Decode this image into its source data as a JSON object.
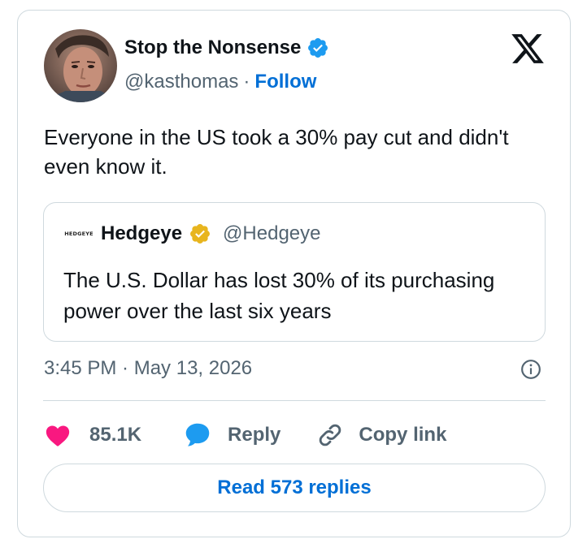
{
  "author": {
    "name": "Stop the Nonsense",
    "handle": "@kasthomas",
    "separator": "·",
    "follow_label": "Follow",
    "verified_color": "#1d9bf0"
  },
  "tweet": {
    "text": "Everyone in the US took a 30% pay cut and didn't even know it."
  },
  "quote": {
    "avatar_text": "HEDGEYE",
    "name": "Hedgeye",
    "handle": "@Hedgeye",
    "text": "The U.S. Dollar has lost 30% of its purchasing power over the last six years",
    "verified_color": "#e8b51e"
  },
  "timestamp": "3:45 PM · May 13, 2026",
  "actions": {
    "likes": "85.1K",
    "reply_label": "Reply",
    "copy_label": "Copy link"
  },
  "read_replies_label": "Read 573 replies",
  "icons": {
    "logo": "x-logo-icon",
    "like": "heart-icon",
    "reply": "speech-bubble-icon",
    "copy": "link-icon",
    "info": "info-icon"
  },
  "colors": {
    "accent": "#006fd6",
    "heart": "#f91880",
    "reply_icon": "#1d9bf0",
    "muted": "#536471",
    "border": "#cfd9de"
  }
}
